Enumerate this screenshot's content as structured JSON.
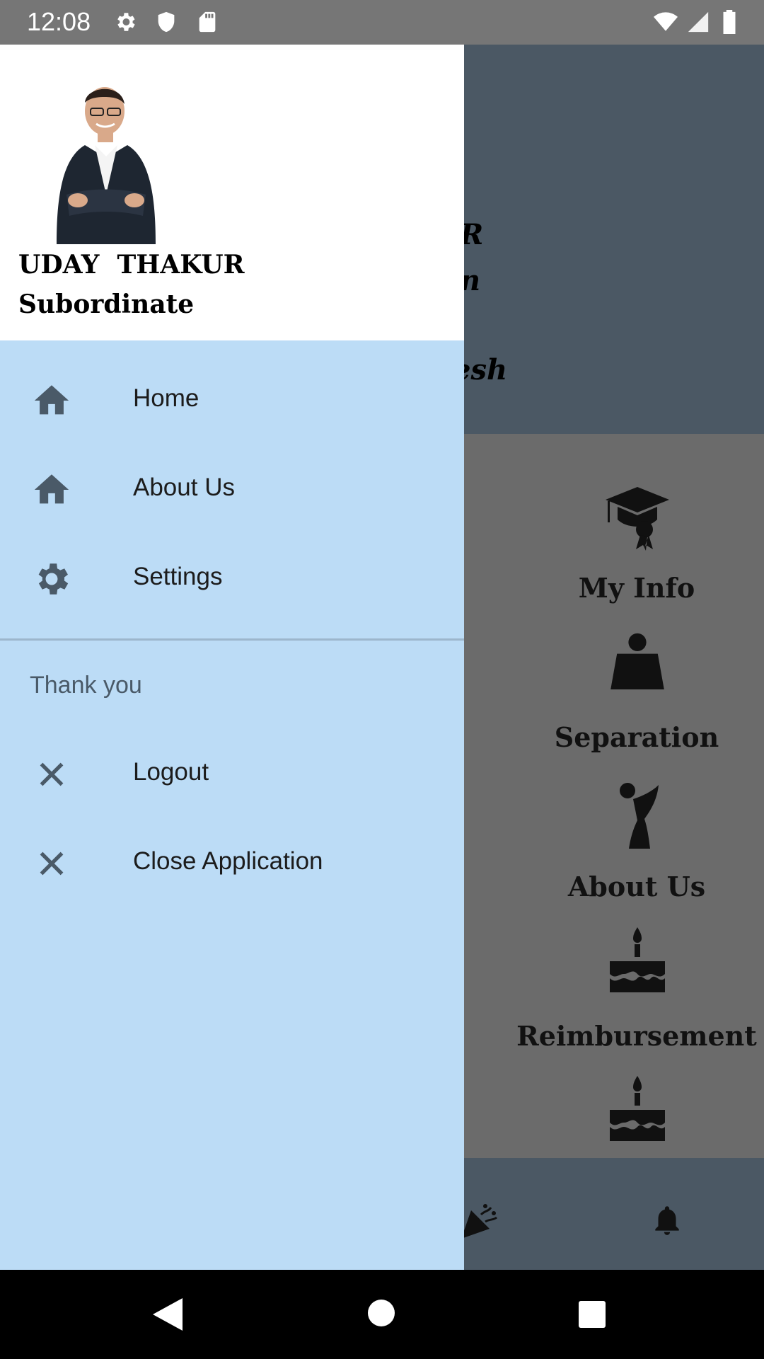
{
  "status_bar": {
    "time": "12:08",
    "icons": [
      "gear-icon",
      "shield-icon",
      "sd-card-icon",
      "wifi-icon",
      "signal-icon",
      "battery-icon"
    ]
  },
  "background_app": {
    "header_fragments": [
      "R",
      "n",
      "esh"
    ],
    "grid": [
      {
        "label": "My Info",
        "icon": "graduation-cap-icon"
      },
      {
        "label": "Separation",
        "icon": "person-desk-icon"
      },
      {
        "label": "About Us",
        "icon": "figure-icon"
      },
      {
        "label": "Reimbursement",
        "icon": "cake-icon"
      },
      {
        "label": "",
        "icon": "cake-icon"
      }
    ],
    "bottom_icons": [
      "celebration-icon",
      "bell-icon"
    ]
  },
  "drawer": {
    "profile": {
      "name": "UDAY  THAKUR",
      "role": "Subordinate"
    },
    "menu": [
      {
        "label": "Home",
        "icon": "home-icon"
      },
      {
        "label": "About Us",
        "icon": "home-icon"
      },
      {
        "label": "Settings",
        "icon": "gear-icon"
      }
    ],
    "section_title": "Thank you",
    "section_items": [
      {
        "label": "Logout",
        "icon": "close-icon"
      },
      {
        "label": "Close Application",
        "icon": "close-icon"
      }
    ]
  },
  "colors": {
    "drawer_bg": "#bcdcf6",
    "header_bg": "#4b5864",
    "scrim": "#6b6b6b",
    "icon": "#4a5a68"
  }
}
